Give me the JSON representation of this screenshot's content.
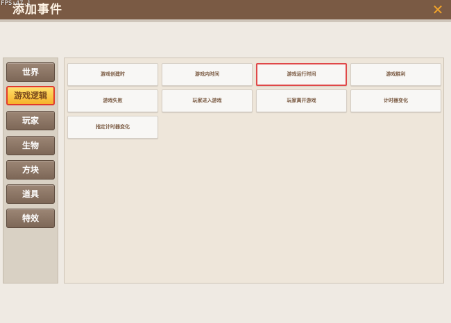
{
  "overlay": {
    "fps": "FPS:47.1"
  },
  "window": {
    "title": "添加事件",
    "close_icon": "close-icon"
  },
  "sidebar": {
    "items": [
      {
        "label": "世界"
      },
      {
        "label": "游戏逻辑",
        "active": true
      },
      {
        "label": "玩家"
      },
      {
        "label": "生物"
      },
      {
        "label": "方块"
      },
      {
        "label": "道具"
      },
      {
        "label": "特效"
      }
    ]
  },
  "events": [
    {
      "label": "游戏创建时"
    },
    {
      "label": "游戏内时间"
    },
    {
      "label": "游戏运行时间",
      "selected": true
    },
    {
      "label": "游戏胜利"
    },
    {
      "label": "游戏失败"
    },
    {
      "label": "玩家进入游戏"
    },
    {
      "label": "玩家离开游戏"
    },
    {
      "label": "计时器变化"
    },
    {
      "label": "指定计时器变化"
    }
  ],
  "colors": {
    "titlebar": "#7a5a44",
    "accent": "#f6b22c",
    "highlight": "#e04848"
  }
}
